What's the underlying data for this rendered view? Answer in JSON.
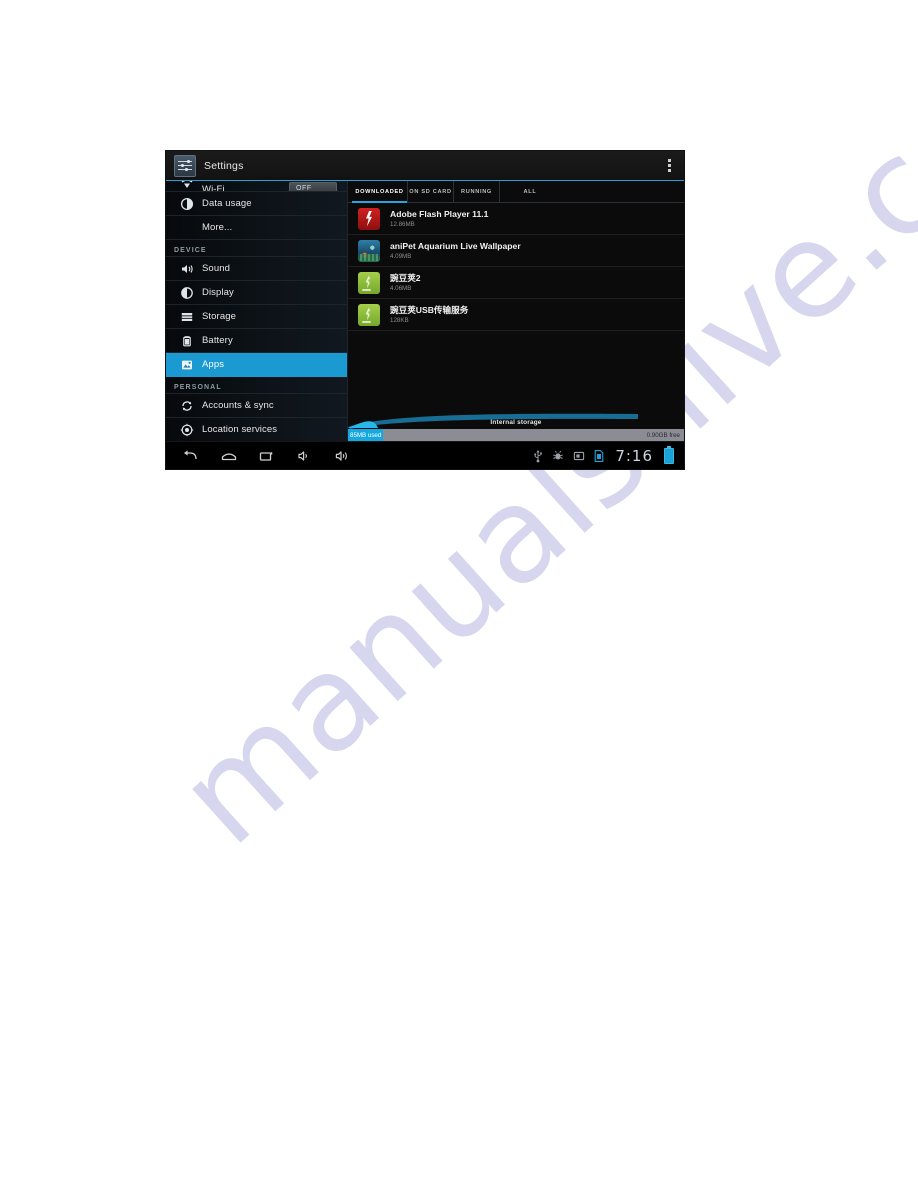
{
  "page": {
    "background": "#ffffff",
    "watermark_text": "manualshive.com"
  },
  "device_screen": {
    "action_bar": {
      "icon": "settings-sliders-icon",
      "title": "Settings",
      "overflow": "overflow-menu-icon"
    },
    "sidebar": {
      "wifi": {
        "label": "Wi-Fi",
        "toggle_value": "OFF",
        "icon": "wifi-icon"
      },
      "items": [
        {
          "label": "Data usage",
          "icon": "data-usage-icon",
          "selected": false,
          "indent": false
        },
        {
          "label": "More...",
          "icon": "",
          "selected": false,
          "indent": true
        }
      ],
      "device_header": "DEVICE",
      "device_items": [
        {
          "label": "Sound",
          "icon": "sound-icon",
          "selected": false
        },
        {
          "label": "Display",
          "icon": "display-icon",
          "selected": false
        },
        {
          "label": "Storage",
          "icon": "storage-icon",
          "selected": false
        },
        {
          "label": "Battery",
          "icon": "battery-icon",
          "selected": false
        },
        {
          "label": "Apps",
          "icon": "apps-icon",
          "selected": true
        }
      ],
      "personal_header": "PERSONAL",
      "personal_items": [
        {
          "label": "Accounts & sync",
          "icon": "sync-icon",
          "selected": false
        },
        {
          "label": "Location services",
          "icon": "location-icon",
          "selected": false
        }
      ]
    },
    "content": {
      "tabs": [
        {
          "label": "DOWNLOADED",
          "active": true
        },
        {
          "label": "ON SD CARD",
          "active": false
        },
        {
          "label": "RUNNING",
          "active": false
        },
        {
          "label": "ALL",
          "active": false
        }
      ],
      "apps": [
        {
          "name": "Adobe Flash Player 11.1",
          "size": "12.86MB",
          "icon": "adobe-flash-icon"
        },
        {
          "name": "aniPet Aquarium Live Wallpaper",
          "size": "4.09MB",
          "icon": "anipet-aquarium-icon"
        },
        {
          "name": "豌豆荚2",
          "size": "4.06MB",
          "icon": "wandoujia-icon"
        },
        {
          "name": "豌豆荚USB传输服务",
          "size": "128KB",
          "icon": "wandoujia-usb-icon"
        }
      ],
      "storage": {
        "title": "Internal storage",
        "used_label": "85MB used",
        "free_label": "0.90GB free",
        "used_percent": 10.5,
        "used_color": "#16a8e0",
        "track_color": "#8c8c94"
      }
    },
    "navigation_bar": {
      "buttons": [
        {
          "name": "back",
          "icon": "back-arrow-icon"
        },
        {
          "name": "home",
          "icon": "home-icon"
        },
        {
          "name": "recents",
          "icon": "recent-apps-icon"
        },
        {
          "name": "volume-down",
          "icon": "volume-down-icon"
        },
        {
          "name": "volume-up",
          "icon": "volume-up-icon"
        }
      ],
      "status_icons": [
        {
          "name": "usb",
          "icon": "usb-icon"
        },
        {
          "name": "usb-debugging",
          "icon": "usb-debug-icon"
        },
        {
          "name": "screenshot",
          "icon": "screenshot-icon"
        },
        {
          "name": "sd-card",
          "icon": "sd-card-icon"
        }
      ],
      "clock": "7:16",
      "battery": "battery-full-icon"
    },
    "accent_color": "#1a9ad0"
  }
}
